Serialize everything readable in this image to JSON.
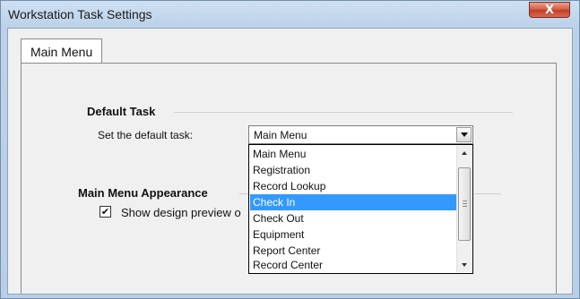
{
  "window": {
    "title": "Workstation Task Settings",
    "close_icon": "close-icon",
    "close_glyph": "X"
  },
  "tabs": [
    {
      "label": "Main Menu",
      "active": true
    }
  ],
  "default_task": {
    "heading": "Default Task",
    "label": "Set the default task:",
    "selected_value": "Main Menu",
    "options": [
      "Main Menu",
      "Registration",
      "Record Lookup",
      "Check In",
      "Check Out",
      "Equipment",
      "Report Center",
      "Record Center"
    ],
    "highlighted_option": "Check In"
  },
  "appearance": {
    "heading": "Main Menu Appearance",
    "checkbox_label": "Show design preview o",
    "checkbox_checked": true,
    "check_glyph": "✔"
  },
  "colors": {
    "selection": "#3399ff",
    "close_button": "#c23d22"
  }
}
